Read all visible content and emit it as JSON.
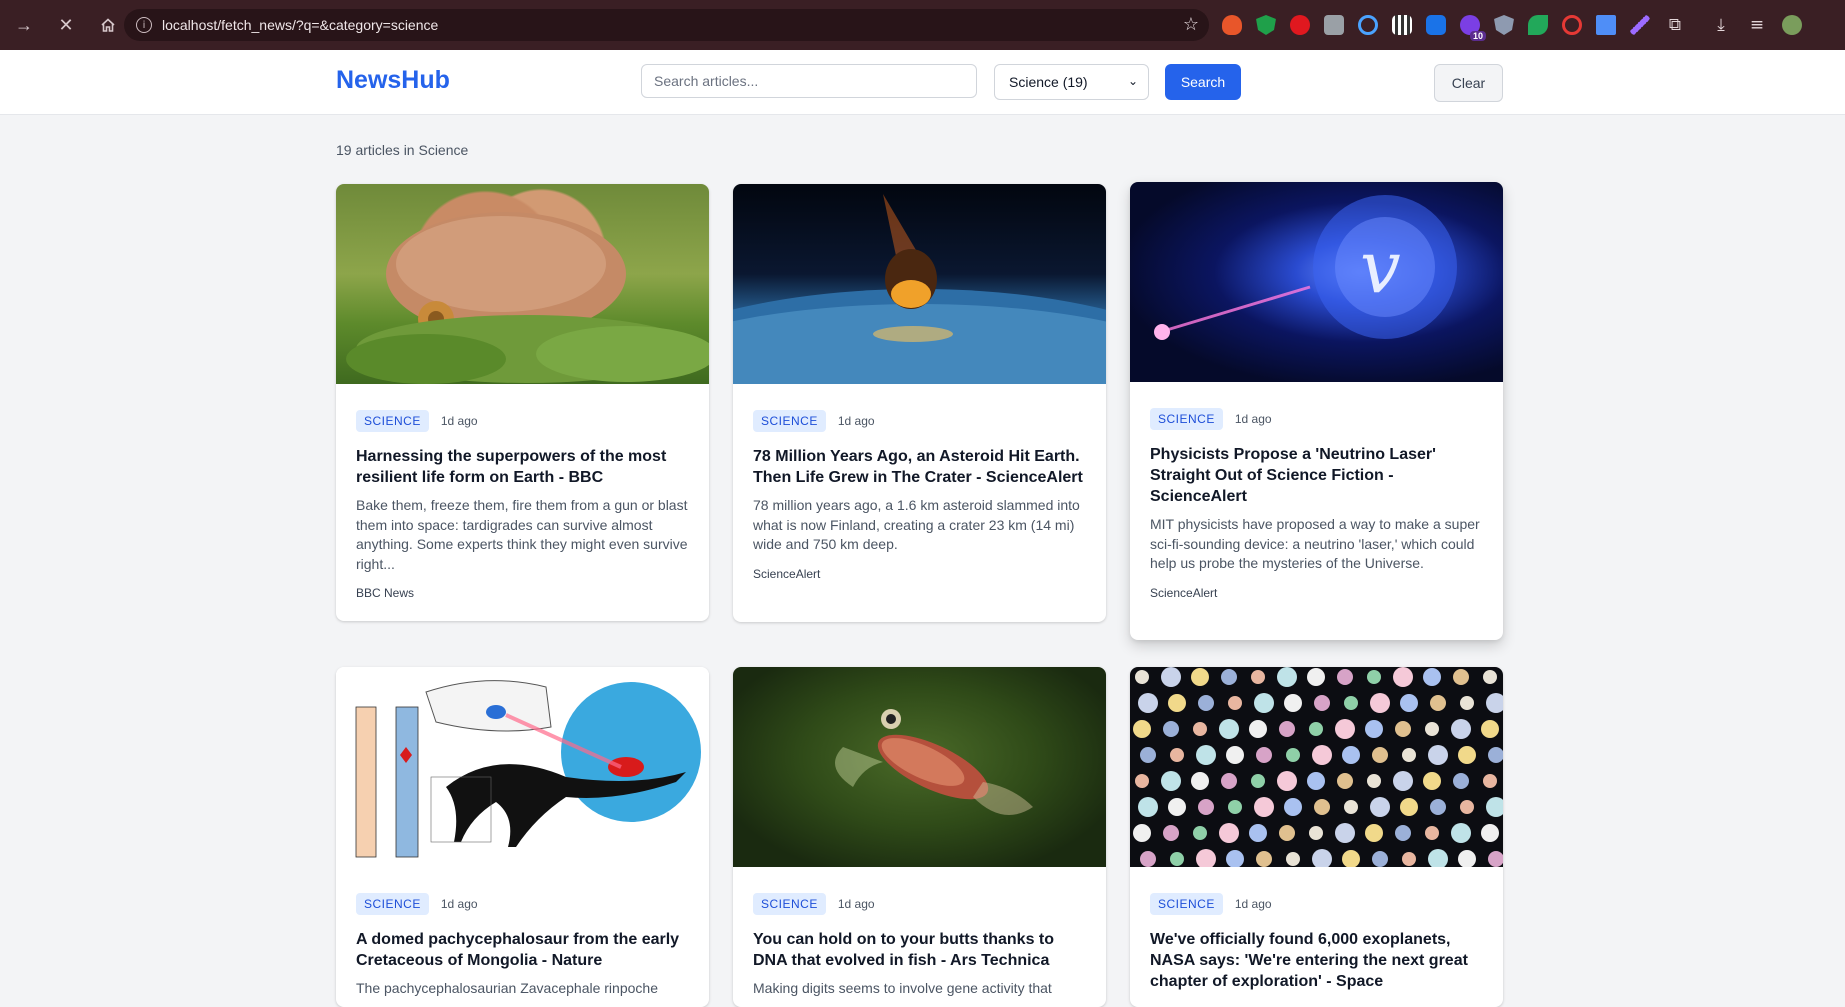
{
  "browser": {
    "url": "localhost/fetch_news/?q=&category=science",
    "extension_badge": "10"
  },
  "header": {
    "logo": "NewsHub",
    "search_placeholder": "Search articles...",
    "category_selected": "Science (19)",
    "search_label": "Search",
    "clear_label": "Clear"
  },
  "results": {
    "summary": "19 articles in Science"
  },
  "articles": [
    {
      "badge": "SCIENCE",
      "time": "1d ago",
      "title": "Harnessing the superpowers of the most resilient life form on Earth - BBC",
      "description": "Bake them, freeze them, fire them from a gun or blast them into space: tardigrades can survive almost anything. Some experts think they might even survive right...",
      "source": "BBC News"
    },
    {
      "badge": "SCIENCE",
      "time": "1d ago",
      "title": "78 Million Years Ago, an Asteroid Hit Earth. Then Life Grew in The Crater - ScienceAlert",
      "description": "78 million years ago, a 1.6 km asteroid slammed into what is now Finland, creating a crater 23 km (14 mi) wide and 750 km deep.",
      "source": "ScienceAlert"
    },
    {
      "badge": "SCIENCE",
      "time": "1d ago",
      "title": "Physicists Propose a 'Neutrino Laser' Straight Out of Science Fiction - ScienceAlert",
      "description": "MIT physicists have proposed a way to make a super sci-fi-sounding device: a neutrino 'laser,' which could help us probe the mysteries of the Universe.",
      "source": "ScienceAlert"
    },
    {
      "badge": "SCIENCE",
      "time": "1d ago",
      "title": "A domed pachycephalosaur from the early Cretaceous of Mongolia - Nature",
      "description": "The pachycephalosaurian Zavacephale rinpoche",
      "source": ""
    },
    {
      "badge": "SCIENCE",
      "time": "1d ago",
      "title": "You can hold on to your butts thanks to DNA that evolved in fish - Ars Technica",
      "description": "Making digits seems to involve gene activity that",
      "source": ""
    },
    {
      "badge": "SCIENCE",
      "time": "1d ago",
      "title": "We've officially found 6,000 exoplanets, NASA says: 'We're entering the next great chapter of exploration' - Space",
      "description": "",
      "source": ""
    }
  ],
  "colors": {
    "brand": "#2563eb",
    "browser_bar": "#3a1f24",
    "badge_bg": "#e0ecff",
    "badge_text": "#1d4ed8"
  }
}
